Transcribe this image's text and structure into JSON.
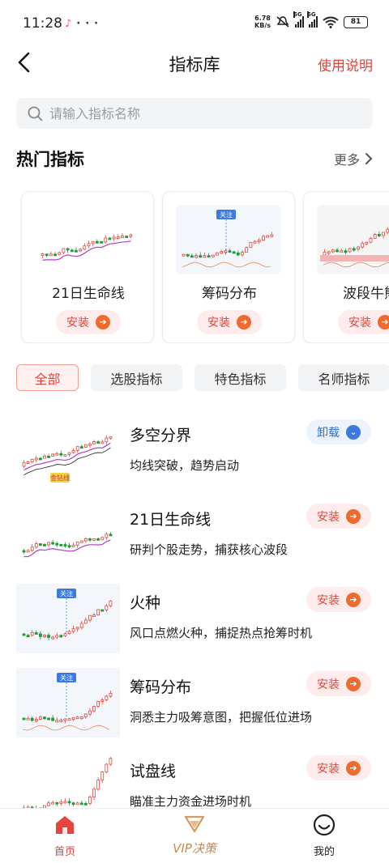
{
  "status_bar": {
    "time": "11:28",
    "net_speed_value": "6.78",
    "net_speed_unit": "KB/s",
    "signal_1_label": "5G",
    "signal_2_label": "5G",
    "battery": "81"
  },
  "nav": {
    "title": "指标库",
    "help_label": "使用说明"
  },
  "search": {
    "placeholder": "请输入指标名称"
  },
  "hot": {
    "title": "热门指标",
    "more_label": "更多",
    "cards": [
      {
        "name": "21日生命线",
        "action": "安装",
        "icon": "arrow-right-icon"
      },
      {
        "name": "筹码分布",
        "action": "安装",
        "icon": "arrow-right-icon",
        "tag": "关注"
      },
      {
        "name": "波段牛熊",
        "action": "安装",
        "icon": "arrow-right-icon"
      }
    ]
  },
  "tabs": [
    "全部",
    "选股指标",
    "特色指标",
    "名师指标"
  ],
  "active_tab": "全部",
  "indicators": [
    {
      "name": "多空分界",
      "desc": "均线突破，趋势启动",
      "action": "卸载",
      "state": "installed",
      "thumb_label": "金钻线"
    },
    {
      "name": "21日生命线",
      "desc": "研判个股走势，捕获核心波段",
      "action": "安装",
      "state": "not-installed"
    },
    {
      "name": "火种",
      "desc": "风口点燃火种，捕捉热点抢筹时机",
      "action": "安装",
      "state": "not-installed",
      "thumb_label": "关注"
    },
    {
      "name": "筹码分布",
      "desc": "洞悉主力吸筹意图，把握低位进场",
      "action": "安装",
      "state": "not-installed",
      "thumb_label": "关注"
    },
    {
      "name": "试盘线",
      "desc": "瞄准主力资金进场时机",
      "action": "安装",
      "state": "not-installed"
    }
  ],
  "bottom_nav": {
    "home_label": "首页",
    "vip_label": "VIP决策",
    "mine_label": "我的"
  },
  "colors": {
    "accent_red": "#e0483f",
    "install_bg": "#fdeceb",
    "uninstall_blue": "#2f6fd6",
    "vip_gold": "#c8874f",
    "candle_up": "#e0483f",
    "candle_down": "#1f9a3a"
  }
}
